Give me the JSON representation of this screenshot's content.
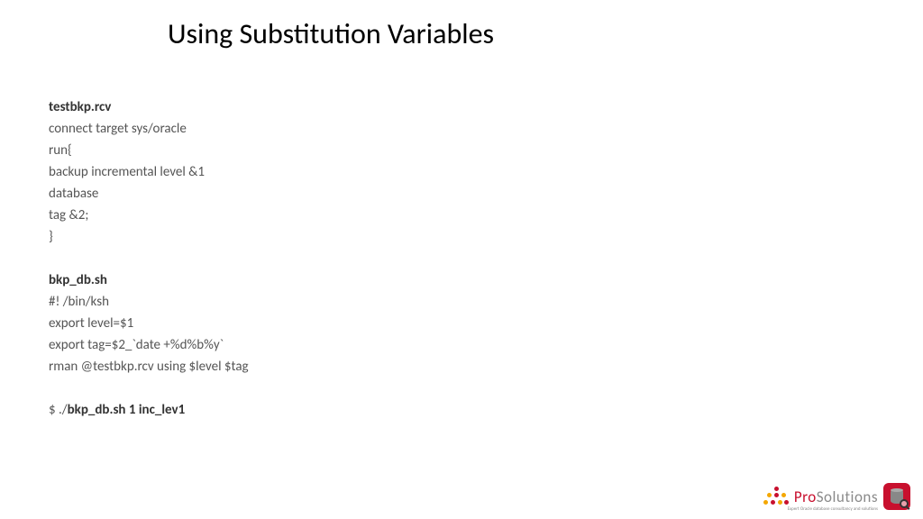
{
  "title": "Using Substitution Variables",
  "section1": {
    "filename": "testbkp.rcv",
    "lines": [
      "connect target sys/oracle",
      "run{",
      "backup incremental level &1",
      "database",
      "tag &2;",
      "}"
    ]
  },
  "section2": {
    "filename": "bkp_db.sh",
    "lines": [
      "#! /bin/ksh",
      "export level=$1",
      "export tag=$2_`date +%d%b%y`",
      "rman @testbkp.rcv using $level $tag"
    ]
  },
  "command": {
    "prefix": "$ ./",
    "bold": "bkp_db.sh 1 inc_lev1"
  },
  "logo": {
    "text1": "Pro",
    "text2": "Solutions",
    "tagline": "Expert Oracle database consultancy and solutions"
  }
}
